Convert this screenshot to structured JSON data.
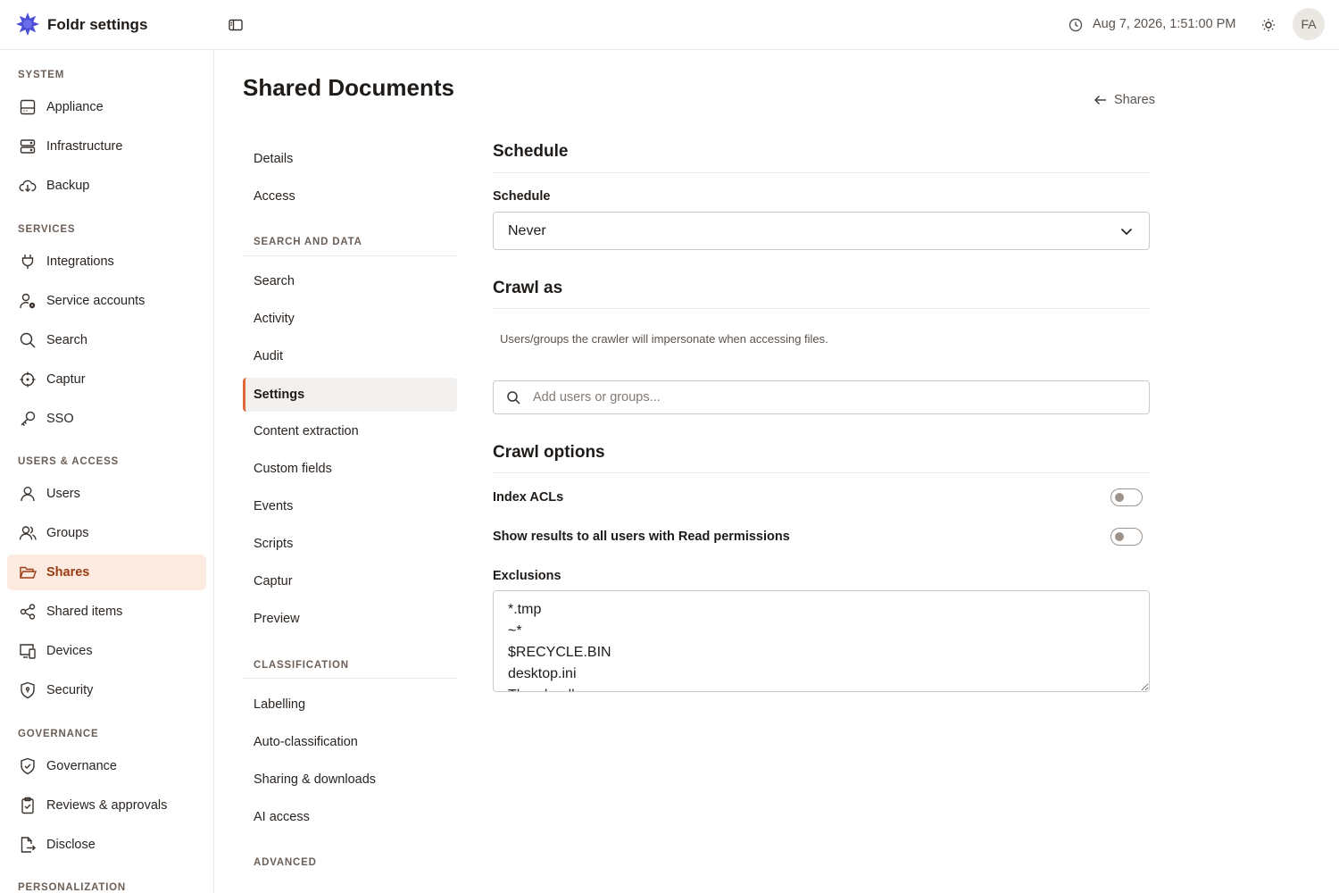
{
  "app": {
    "title": "Foldr settings",
    "datetime": "Aug 7, 2026, 1:51:00 PM",
    "avatar_initials": "FA",
    "accent_color": "#e0693a",
    "logo_color": "#4b4fd6"
  },
  "sidebar": {
    "sections": {
      "system": "SYSTEM",
      "services": "SERVICES",
      "users_access": "USERS & ACCESS",
      "governance": "GOVERNANCE",
      "personalization": "PERSONALIZATION"
    },
    "items": {
      "appliance": "Appliance",
      "infrastructure": "Infrastructure",
      "backup": "Backup",
      "integrations": "Integrations",
      "service_accounts": "Service accounts",
      "search": "Search",
      "captur": "Captur",
      "sso": "SSO",
      "users": "Users",
      "groups": "Groups",
      "shares": "Shares",
      "shared_items": "Shared items",
      "devices": "Devices",
      "security": "Security",
      "governance": "Governance",
      "reviews": "Reviews & approvals",
      "disclose": "Disclose"
    },
    "active": "shares"
  },
  "page": {
    "title": "Shared Documents",
    "back_label": "Shares"
  },
  "subnav": {
    "items_top": [
      "Details",
      "Access"
    ],
    "section_search": "SEARCH AND DATA",
    "items_search": [
      "Search",
      "Activity",
      "Audit",
      "Settings",
      "Content extraction",
      "Custom fields",
      "Events",
      "Scripts",
      "Captur",
      "Preview"
    ],
    "section_classification": "CLASSIFICATION",
    "items_classification": [
      "Labelling",
      "Auto-classification",
      "Sharing & downloads",
      "AI access"
    ],
    "section_advanced": "ADVANCED",
    "active": "Settings"
  },
  "schedule": {
    "heading": "Schedule",
    "label": "Schedule",
    "value": "Never"
  },
  "crawl_as": {
    "heading": "Crawl as",
    "help": "Users/groups the crawler will impersonate when accessing files.",
    "placeholder": "Add users or groups..."
  },
  "crawl_options": {
    "heading": "Crawl options",
    "index_acls_label": "Index ACLs",
    "index_acls_on": false,
    "show_results_label": "Show results to all users with Read permissions",
    "show_results_on": false,
    "exclusions_label": "Exclusions",
    "exclusions_value": "*.tmp\n~*\n$RECYCLE.BIN\ndesktop.ini\nThumbs.db"
  }
}
